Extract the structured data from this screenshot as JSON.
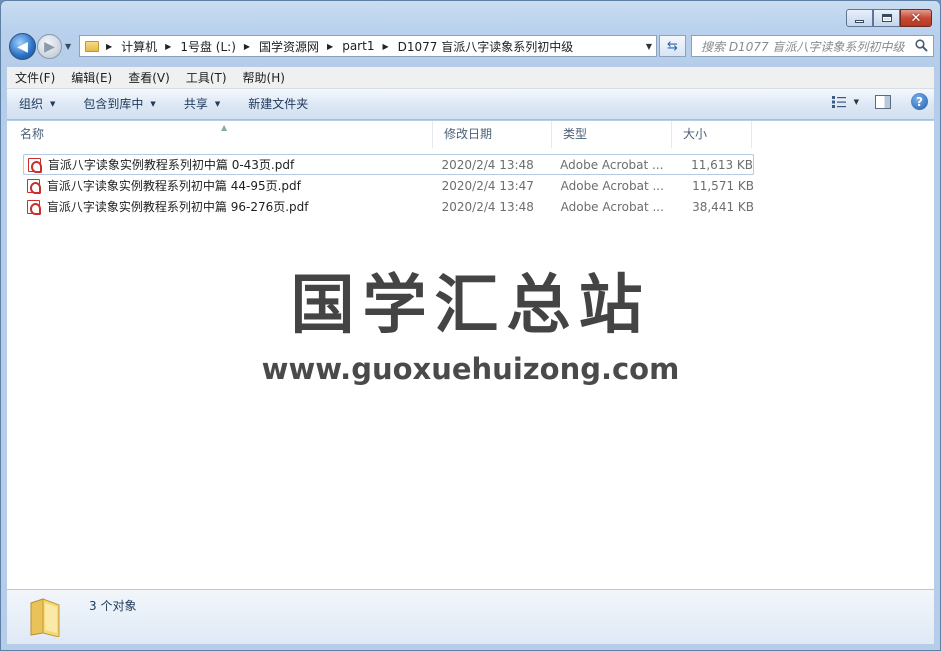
{
  "window": {
    "caption_buttons": [
      "minimize",
      "maximize",
      "close"
    ]
  },
  "nav": {
    "breadcrumbs": [
      "计算机",
      "1号盘 (L:)",
      "国学资源网",
      "part1",
      "D1077 盲派八字读象系列初中级"
    ],
    "search_placeholder": "搜索 D1077 盲派八字读象系列初中级"
  },
  "menu": [
    "文件(F)",
    "编辑(E)",
    "查看(V)",
    "工具(T)",
    "帮助(H)"
  ],
  "commands": {
    "organize": "组织",
    "include_library": "包含到库中",
    "share": "共享",
    "new_folder": "新建文件夹"
  },
  "columns": {
    "name": "名称",
    "date": "修改日期",
    "type": "类型",
    "size": "大小"
  },
  "files": [
    {
      "name": "盲派八字读象实例教程系列初中篇 0-43页.pdf",
      "date": "2020/2/4 13:48",
      "type": "Adobe Acrobat ...",
      "size": "11,613 KB"
    },
    {
      "name": "盲派八字读象实例教程系列初中篇 44-95页.pdf",
      "date": "2020/2/4 13:47",
      "type": "Adobe Acrobat ...",
      "size": "11,571 KB"
    },
    {
      "name": "盲派八字读象实例教程系列初中篇 96-276页.pdf",
      "date": "2020/2/4 13:48",
      "type": "Adobe Acrobat ...",
      "size": "38,441 KB"
    }
  ],
  "watermark": {
    "title": "国学汇总站",
    "url": "www.guoxuehuizong.com"
  },
  "details": {
    "count_text": "3 个对象"
  }
}
